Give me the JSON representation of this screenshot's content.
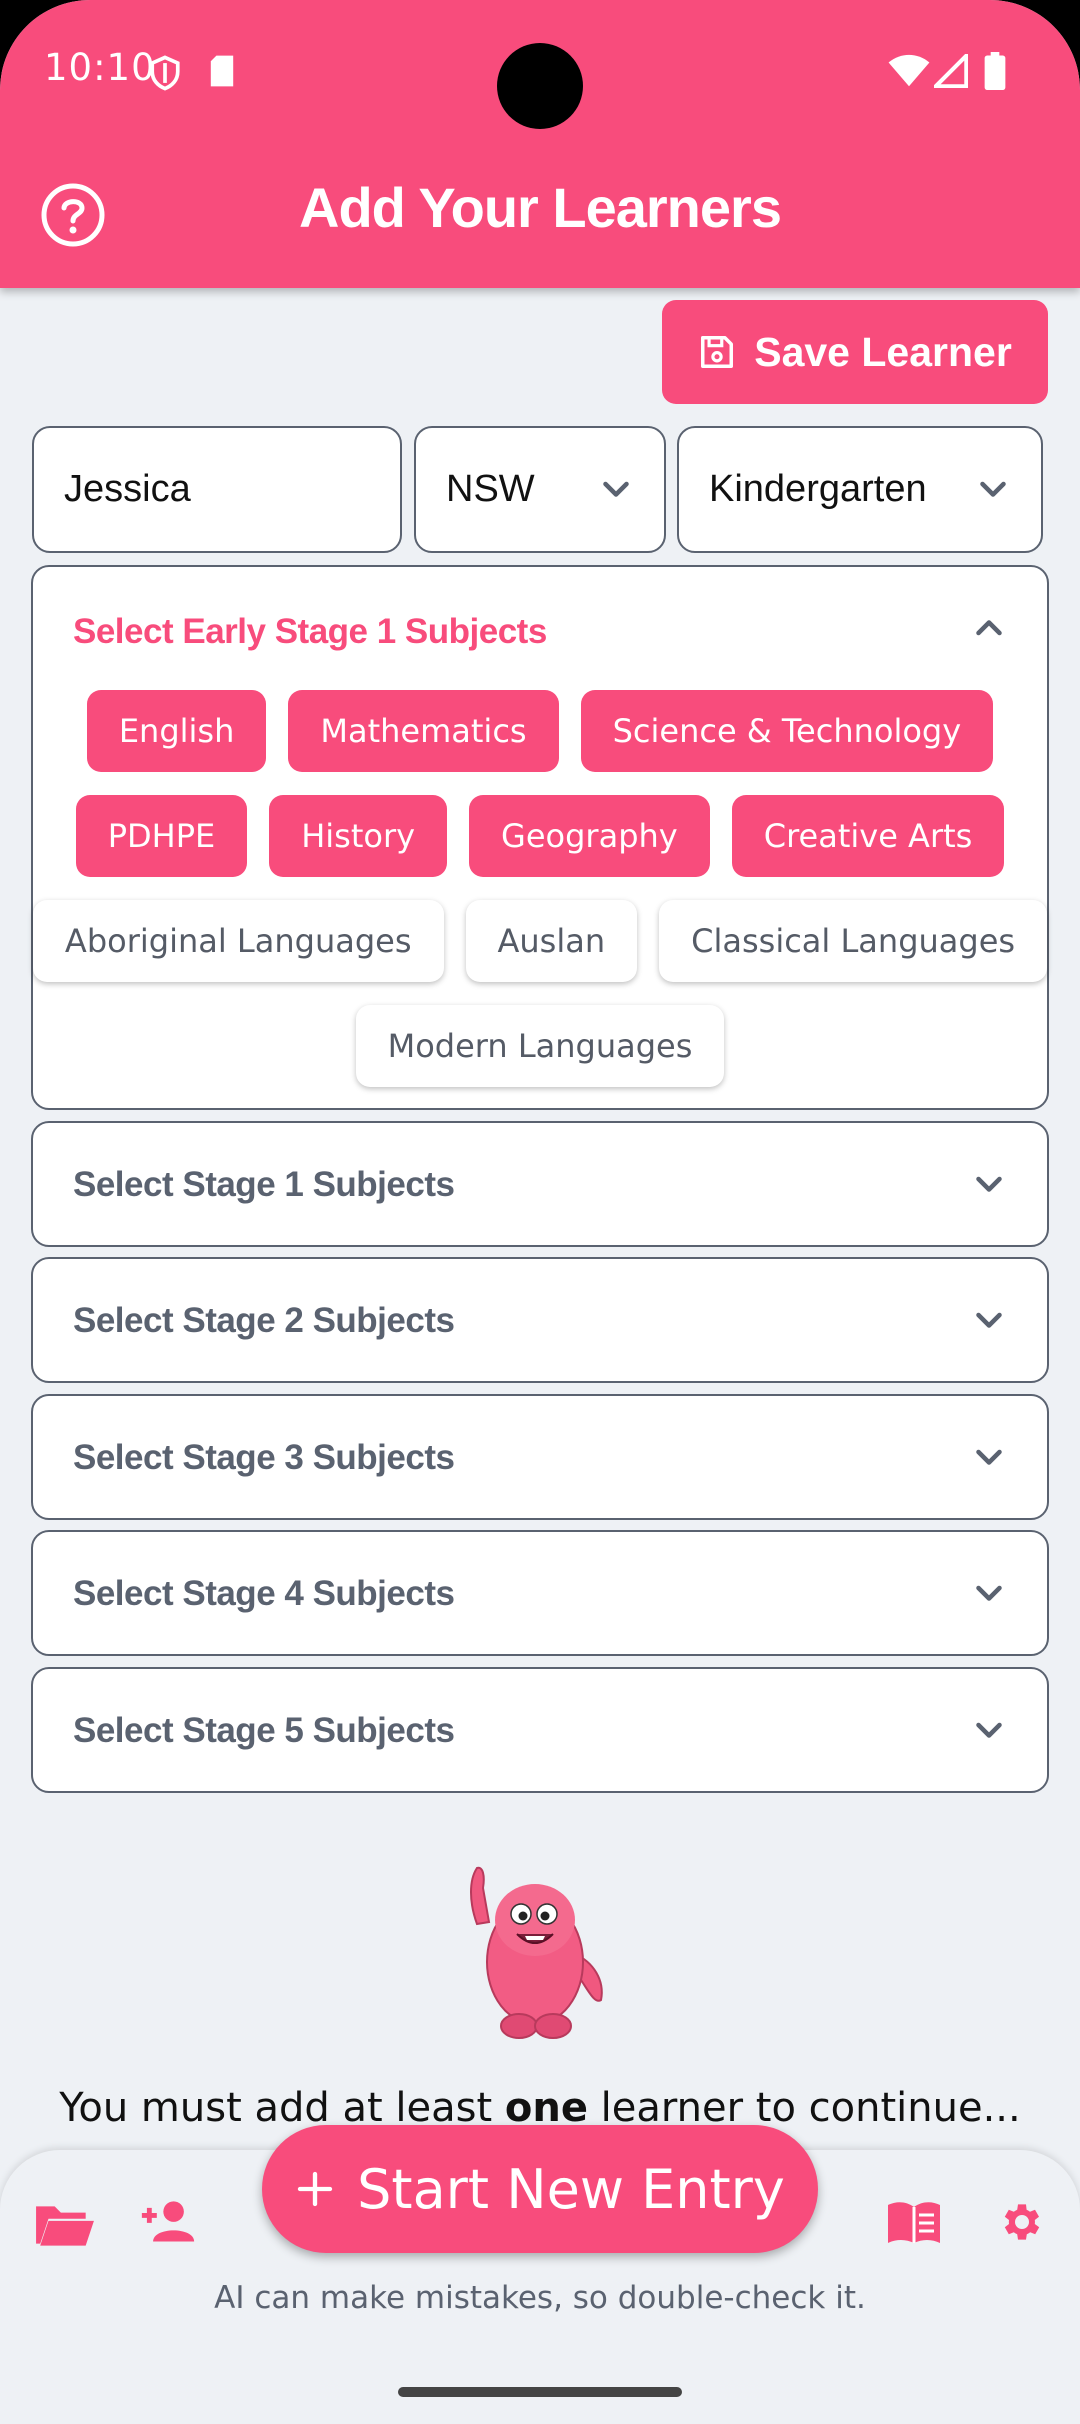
{
  "status": {
    "time": "10:10"
  },
  "header": {
    "title": "Add Your Learners"
  },
  "actions": {
    "save_label": "Save Learner"
  },
  "form": {
    "name_value": "Jessica",
    "state_value": "NSW",
    "year_value": "Kindergarten"
  },
  "early_stage": {
    "title": "Select Early Stage 1 Subjects",
    "selected": [
      "English",
      "Mathematics",
      "Science & Technology",
      "PDHPE",
      "History",
      "Geography",
      "Creative Arts"
    ],
    "unselected": [
      "Aboriginal Languages",
      "Auslan",
      "Classical Languages",
      "Modern Languages"
    ]
  },
  "stages": [
    {
      "title": "Select Stage 1 Subjects"
    },
    {
      "title": "Select Stage 2 Subjects"
    },
    {
      "title": "Select Stage 3 Subjects"
    },
    {
      "title": "Select Stage 4 Subjects"
    },
    {
      "title": "Select Stage 5 Subjects"
    }
  ],
  "notice": {
    "prefix": "You must add at least ",
    "emphasis": "one",
    "suffix": " learner to continue..."
  },
  "bottom": {
    "fab_label": "Start New Entry",
    "disclaimer": "AI can make mistakes, so double-check it."
  },
  "colors": {
    "accent": "#f84c7c",
    "background": "#eef1f5",
    "border": "#5a6270"
  },
  "icons": [
    "help-icon",
    "save-icon",
    "chevron-down-icon",
    "chevron-up-icon",
    "folder-icon",
    "add-person-icon",
    "book-icon",
    "gear-icon",
    "plus-icon"
  ]
}
